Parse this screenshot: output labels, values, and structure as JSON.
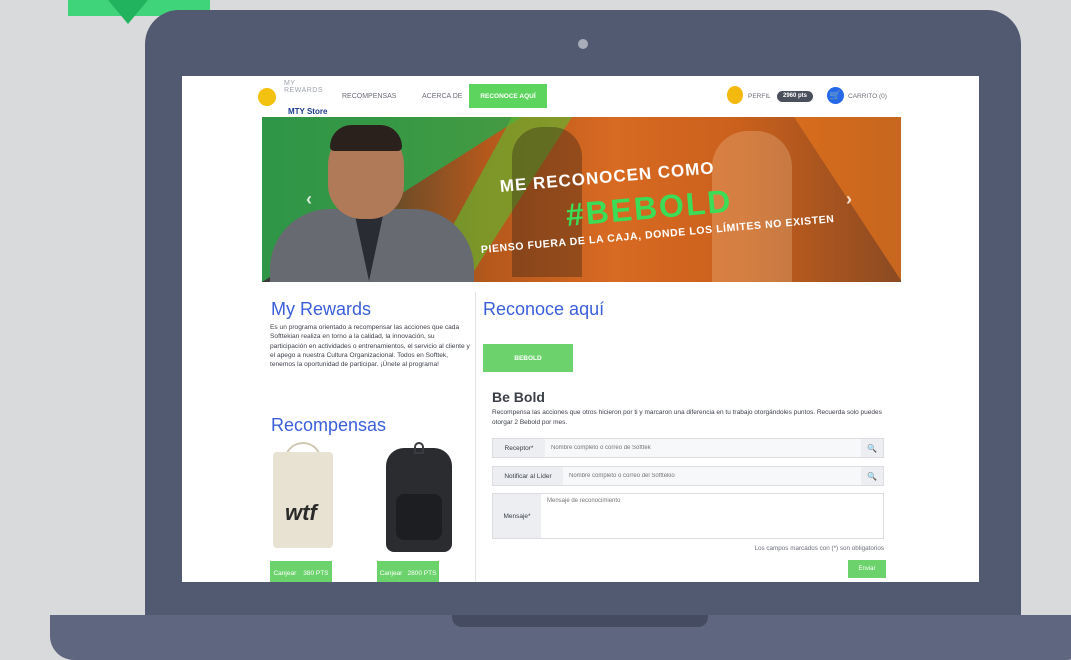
{
  "nav": {
    "logo_line1": "MY",
    "logo_line2": "REWARDS",
    "logo_sub": "MTY Store",
    "links": [
      "RECOMPENSAS",
      "ACERCA DE"
    ],
    "cta": "RECONOCE AQUÍ",
    "perfil_label": "PERFIL",
    "points_badge": "2960 pts",
    "cart_label": "CARRITO (0)"
  },
  "hero": {
    "line1": "ME RECONOCEN COMO",
    "line2": "#BEBOLD",
    "line3": "PIENSO FUERA DE LA CAJA, DONDE LOS LÍMITES NO EXISTEN",
    "prev": "‹",
    "next": "›"
  },
  "left": {
    "rewards_title": "My Rewards",
    "rewards_text": "Es un programa orientado a recompensar las acciones que cada Softtekian realiza en torno a la calidad, la innovación, su participación en actividades o entrenamientos, el servicio al cliente y el apego a nuestra Cultura Organizacional. Todos en Softtek, tenemos la oportunidad de participar. ¡Únete al programa!",
    "recompensas_title": "Recompensas",
    "products": [
      {
        "logo": "wtf",
        "button": "Canjear",
        "price": "380 PTS"
      },
      {
        "button": "Canjear",
        "price": "2800 PTS"
      }
    ]
  },
  "right": {
    "title": "Reconoce aquí",
    "pill": "BEBOLD",
    "bebold_title": "Be Bold",
    "bebold_text": "Recompensa las acciones que otros hicieron por ti y marcaron una diferencia en tu trabajo otorgándoles puntos. Recuerda solo puedes otorgar 2 Bebold por mes.",
    "receptor_label": "Receptor*",
    "receptor_placeholder": "Nombre completo o correo de Softtek",
    "lider_label": "Notificar al Líder",
    "lider_placeholder": "Nombre completo o correo del Softtekio",
    "mensaje_label": "Mensaje*",
    "mensaje_placeholder": "Mensaje de reconocimiento",
    "required_note": "Los campos marcados con (*) son obligatorios",
    "enviar": "Enviar"
  }
}
